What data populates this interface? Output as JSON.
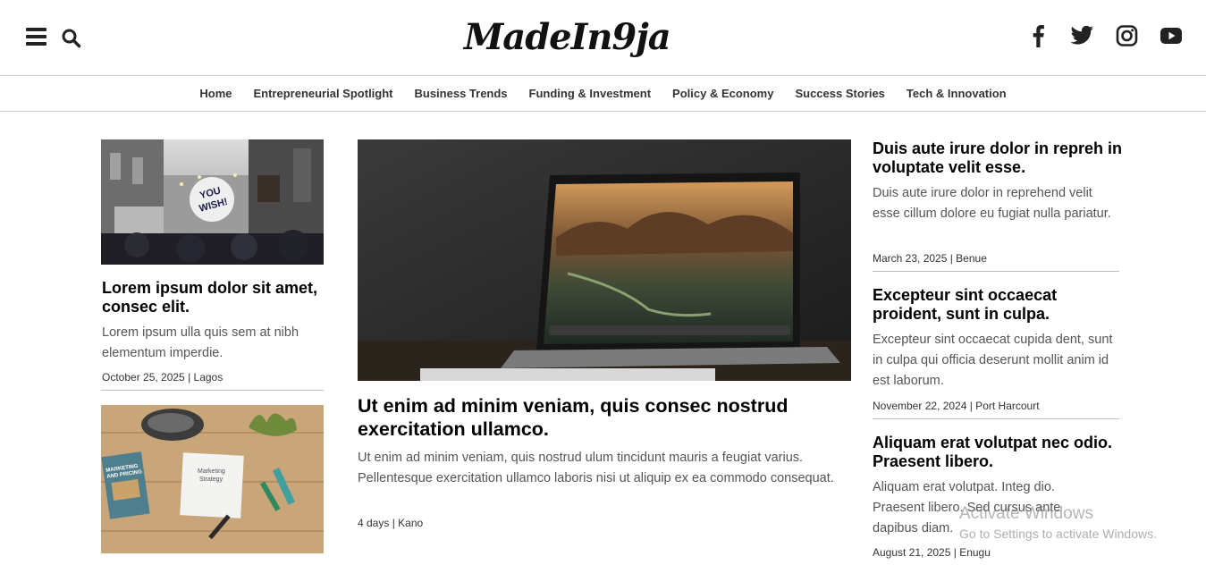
{
  "header": {
    "logo": "MadeIn9ja",
    "menu_icon": "hamburger-menu-icon",
    "search_icon": "search-icon",
    "social_icons": [
      "facebook-icon",
      "twitter-icon",
      "instagram-icon",
      "youtube-icon"
    ]
  },
  "nav": {
    "items": [
      "Home",
      "Entrepreneurial Spotlight",
      "Business Trends",
      "Funding & Investment",
      "Policy & Economy",
      "Success Stories",
      "Tech & Innovation"
    ]
  },
  "left": {
    "article1": {
      "image_label": "YOU WISH!",
      "title": "Lorem ipsum dolor sit amet, consec elit.",
      "excerpt": "Lorem ipsum ulla quis sem at nibh elementum imperdie.",
      "meta": "October 25, 2025 | Lagos"
    },
    "article2": {
      "image_label": "Marketing Strategy",
      "book_label": "MARKETING AND PRICING"
    }
  },
  "center": {
    "title": "Ut enim ad minim veniam, quis consec nostrud exercitation ullamco.",
    "excerpt": "Ut enim ad minim veniam, quis nostrud ulum tincidunt mauris a feugiat varius. Pellentesque exercitation ullamco laboris nisi ut aliquip ex ea commodo consequat.",
    "meta": "4 days | Kano"
  },
  "right": {
    "articles": [
      {
        "title": "Duis aute irure dolor in repreh in voluptate velit esse.",
        "excerpt": "Duis aute irure dolor in reprehend velit esse cillum dolore eu fugiat nulla pariatur.",
        "meta": "March 23, 2025 | Benue"
      },
      {
        "title": "Excepteur sint occaecat proident, sunt in culpa.",
        "excerpt": "Excepteur sint occaecat cupida dent, sunt in culpa qui officia deserunt mollit anim id est laborum.",
        "meta": "November 22, 2024 | Port Harcourt"
      },
      {
        "title": "Aliquam erat volutpat nec odio. Praesent libero.",
        "excerpt": "Aliquam erat volutpat. Integ dio. Praesent libero. Sed cursus ante dapibus diam.",
        "meta": "August 21, 2025 | Enugu"
      }
    ]
  },
  "watermark": {
    "title": "Activate Windows",
    "subtitle": "Go to Settings to activate Windows."
  }
}
